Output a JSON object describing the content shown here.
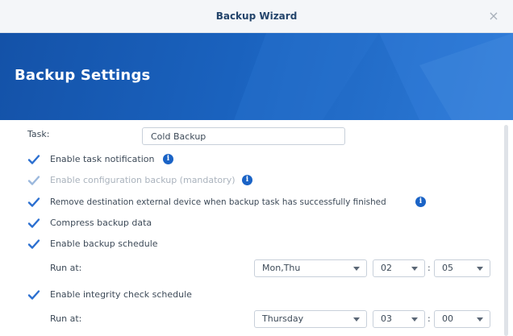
{
  "window": {
    "title": "Backup Wizard",
    "close_glyph": "×"
  },
  "banner": {
    "heading": "Backup Settings"
  },
  "form": {
    "task_label": "Task:",
    "task_value": "Cold Backup",
    "options": [
      {
        "label": "Enable task notification",
        "checked": true,
        "disabled": false,
        "info": true
      },
      {
        "label": "Enable configuration backup (mandatory)",
        "checked": true,
        "disabled": true,
        "info": true
      },
      {
        "label": "Remove destination external device when backup task has successfully finished",
        "checked": true,
        "disabled": false,
        "info": true
      },
      {
        "label": "Compress backup data",
        "checked": true,
        "disabled": false,
        "info": false
      },
      {
        "label": "Enable backup schedule",
        "checked": true,
        "disabled": false,
        "info": false
      }
    ],
    "backup_schedule": {
      "run_at_label": "Run at:",
      "days": "Mon,Thu",
      "hour": "02",
      "minute": "05",
      "separator": ":"
    },
    "integrity": {
      "label": "Enable integrity check schedule",
      "checked": true
    },
    "integrity_schedule": {
      "run_at_label": "Run at:",
      "days": "Thursday",
      "hour": "03",
      "minute": "00",
      "separator": ":"
    }
  },
  "icons": {
    "info": "i",
    "check": "check-icon"
  },
  "colors": {
    "accent": "#1a63c6",
    "banner": "#1a5fb8",
    "check": "#2b6fd0",
    "check_disabled": "#9bb8dd"
  }
}
